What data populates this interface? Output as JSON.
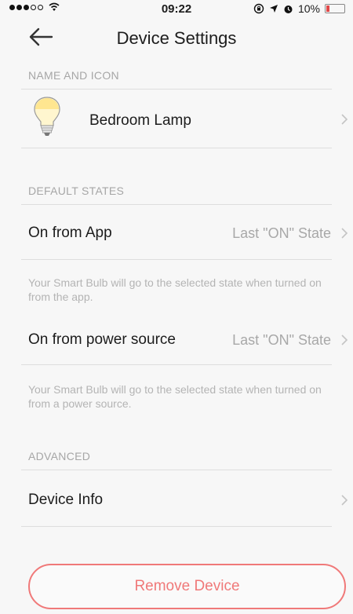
{
  "status_bar": {
    "time": "09:22",
    "battery_percent": "10%",
    "signal_strength": 3,
    "signal_total": 5,
    "colors": {
      "battery_low": "#e04848"
    }
  },
  "header": {
    "title": "Device Settings"
  },
  "sections": {
    "name_icon": {
      "header": "NAME AND ICON",
      "device_name": "Bedroom Lamp"
    },
    "default_states": {
      "header": "DEFAULT STATES",
      "on_from_app": {
        "label": "On from App",
        "value": "Last \"ON\" State",
        "note": "Your Smart Bulb will go to the selected state when turned on from the app."
      },
      "on_from_power": {
        "label": "On from power source",
        "value": "Last \"ON\" State",
        "note": "Your Smart Bulb will go to the selected state when turned on from a power source."
      }
    },
    "advanced": {
      "header": "ADVANCED",
      "device_info": {
        "label": "Device Info"
      }
    }
  },
  "actions": {
    "remove_label": "Remove Device"
  },
  "colors": {
    "accent": "#f07979",
    "muted_text": "#a6a6a6",
    "background": "#f7f7f7"
  }
}
